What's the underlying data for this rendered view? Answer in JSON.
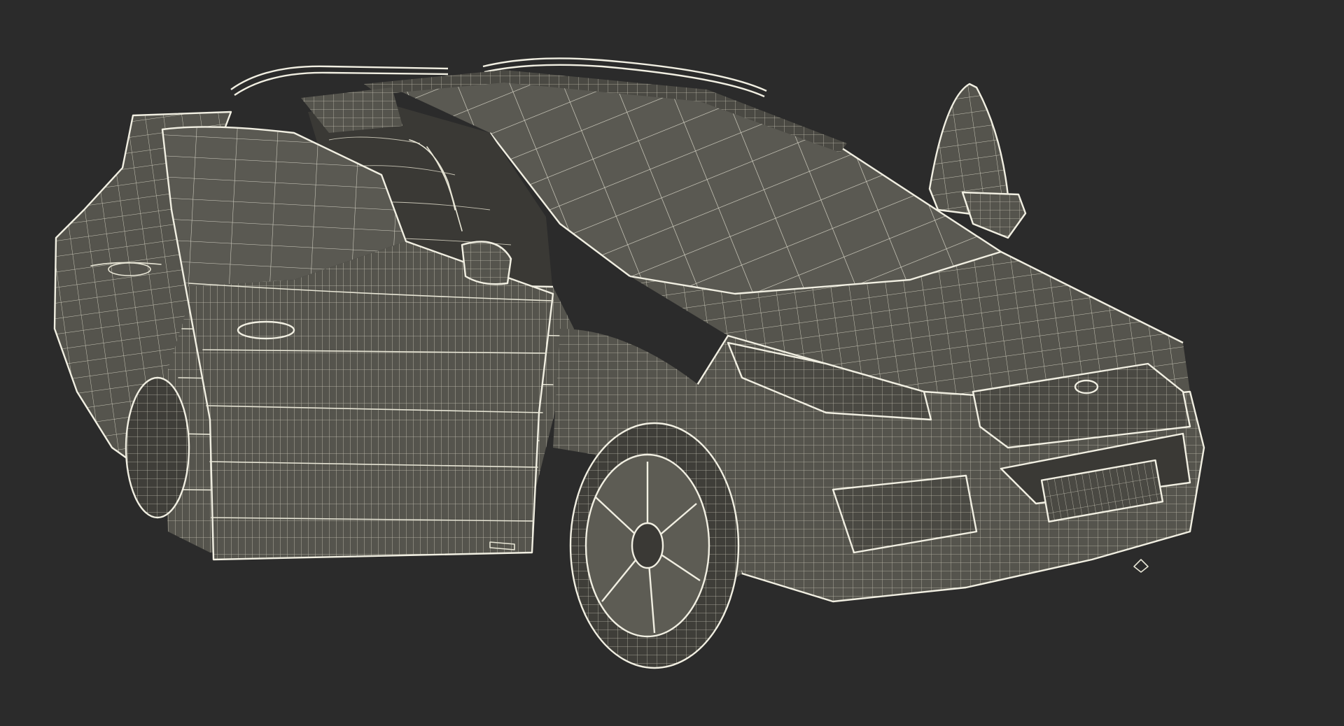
{
  "scene": {
    "subject": "car-wireframe-render",
    "background_color": "#2b2b2b",
    "mesh_fill_color": "#55544d",
    "wire_color": "#e8e6d6",
    "doors_open": [
      "front-left-door",
      "rear-left-door",
      "front-right-door"
    ]
  }
}
